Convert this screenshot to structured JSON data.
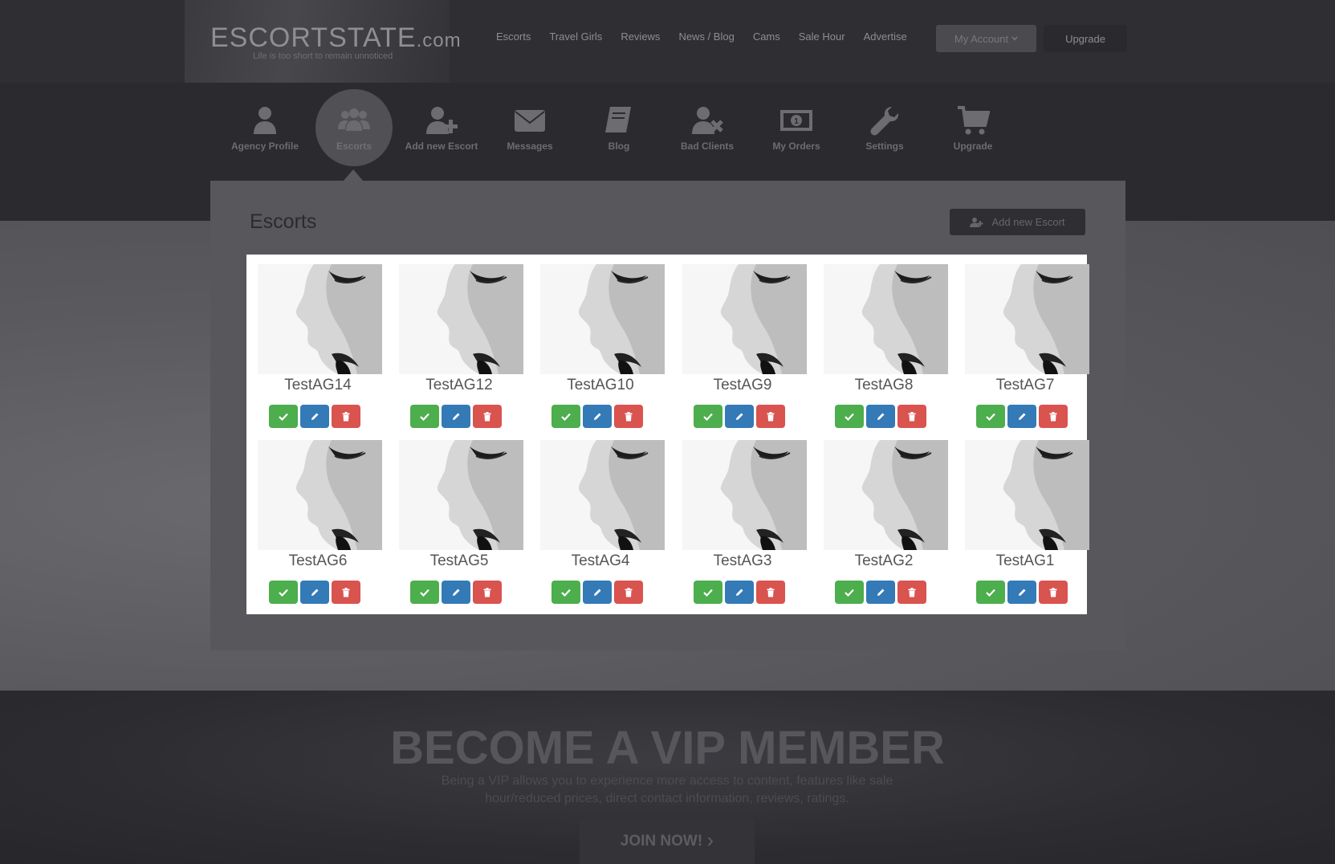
{
  "site": {
    "logo_main": "ESCORTSTATE",
    "logo_suffix": ".com",
    "tagline": "Life is too short to remain unnoticed"
  },
  "topnav": [
    "Escorts",
    "Travel Girls",
    "Reviews",
    "News / Blog",
    "Cams",
    "Sale Hour",
    "Advertise"
  ],
  "header_buttons": {
    "account": "My Account",
    "upgrade": "Upgrade"
  },
  "dashboard_nav": [
    {
      "label": "Agency Profile",
      "icon": "user-icon",
      "active": false
    },
    {
      "label": "Escorts",
      "icon": "group-icon",
      "active": true
    },
    {
      "label": "Add new Escort",
      "icon": "user-plus-icon",
      "active": false
    },
    {
      "label": "Messages",
      "icon": "envelope-icon",
      "active": false
    },
    {
      "label": "Blog",
      "icon": "book-icon",
      "active": false
    },
    {
      "label": "Bad Clients",
      "icon": "user-x-icon",
      "active": false
    },
    {
      "label": "My Orders",
      "icon": "money-icon",
      "active": false
    },
    {
      "label": "Settings",
      "icon": "wrench-icon",
      "active": false
    },
    {
      "label": "Upgrade",
      "icon": "cart-icon",
      "active": false
    }
  ],
  "panel": {
    "title": "Escorts",
    "add_button": "Add new Escort"
  },
  "escorts": [
    {
      "name": "TestAG14"
    },
    {
      "name": "TestAG12"
    },
    {
      "name": "TestAG10"
    },
    {
      "name": "TestAG9"
    },
    {
      "name": "TestAG8"
    },
    {
      "name": "TestAG7"
    },
    {
      "name": "TestAG6"
    },
    {
      "name": "TestAG5"
    },
    {
      "name": "TestAG4"
    },
    {
      "name": "TestAG3"
    },
    {
      "name": "TestAG2"
    },
    {
      "name": "TestAG1"
    }
  ],
  "actions": {
    "activate_icon": "check-icon",
    "edit_icon": "pencil-icon",
    "delete_icon": "trash-icon"
  },
  "colors": {
    "activate": "#4cae4c",
    "edit": "#337ab7",
    "delete": "#d9534f"
  },
  "promo": {
    "title": "BECOME A VIP MEMBER",
    "text": "Being a VIP allows you to experience more access to content, features like sale hour/reduced prices, direct contact information, reviews, ratings.",
    "button": "JOIN NOW!"
  }
}
